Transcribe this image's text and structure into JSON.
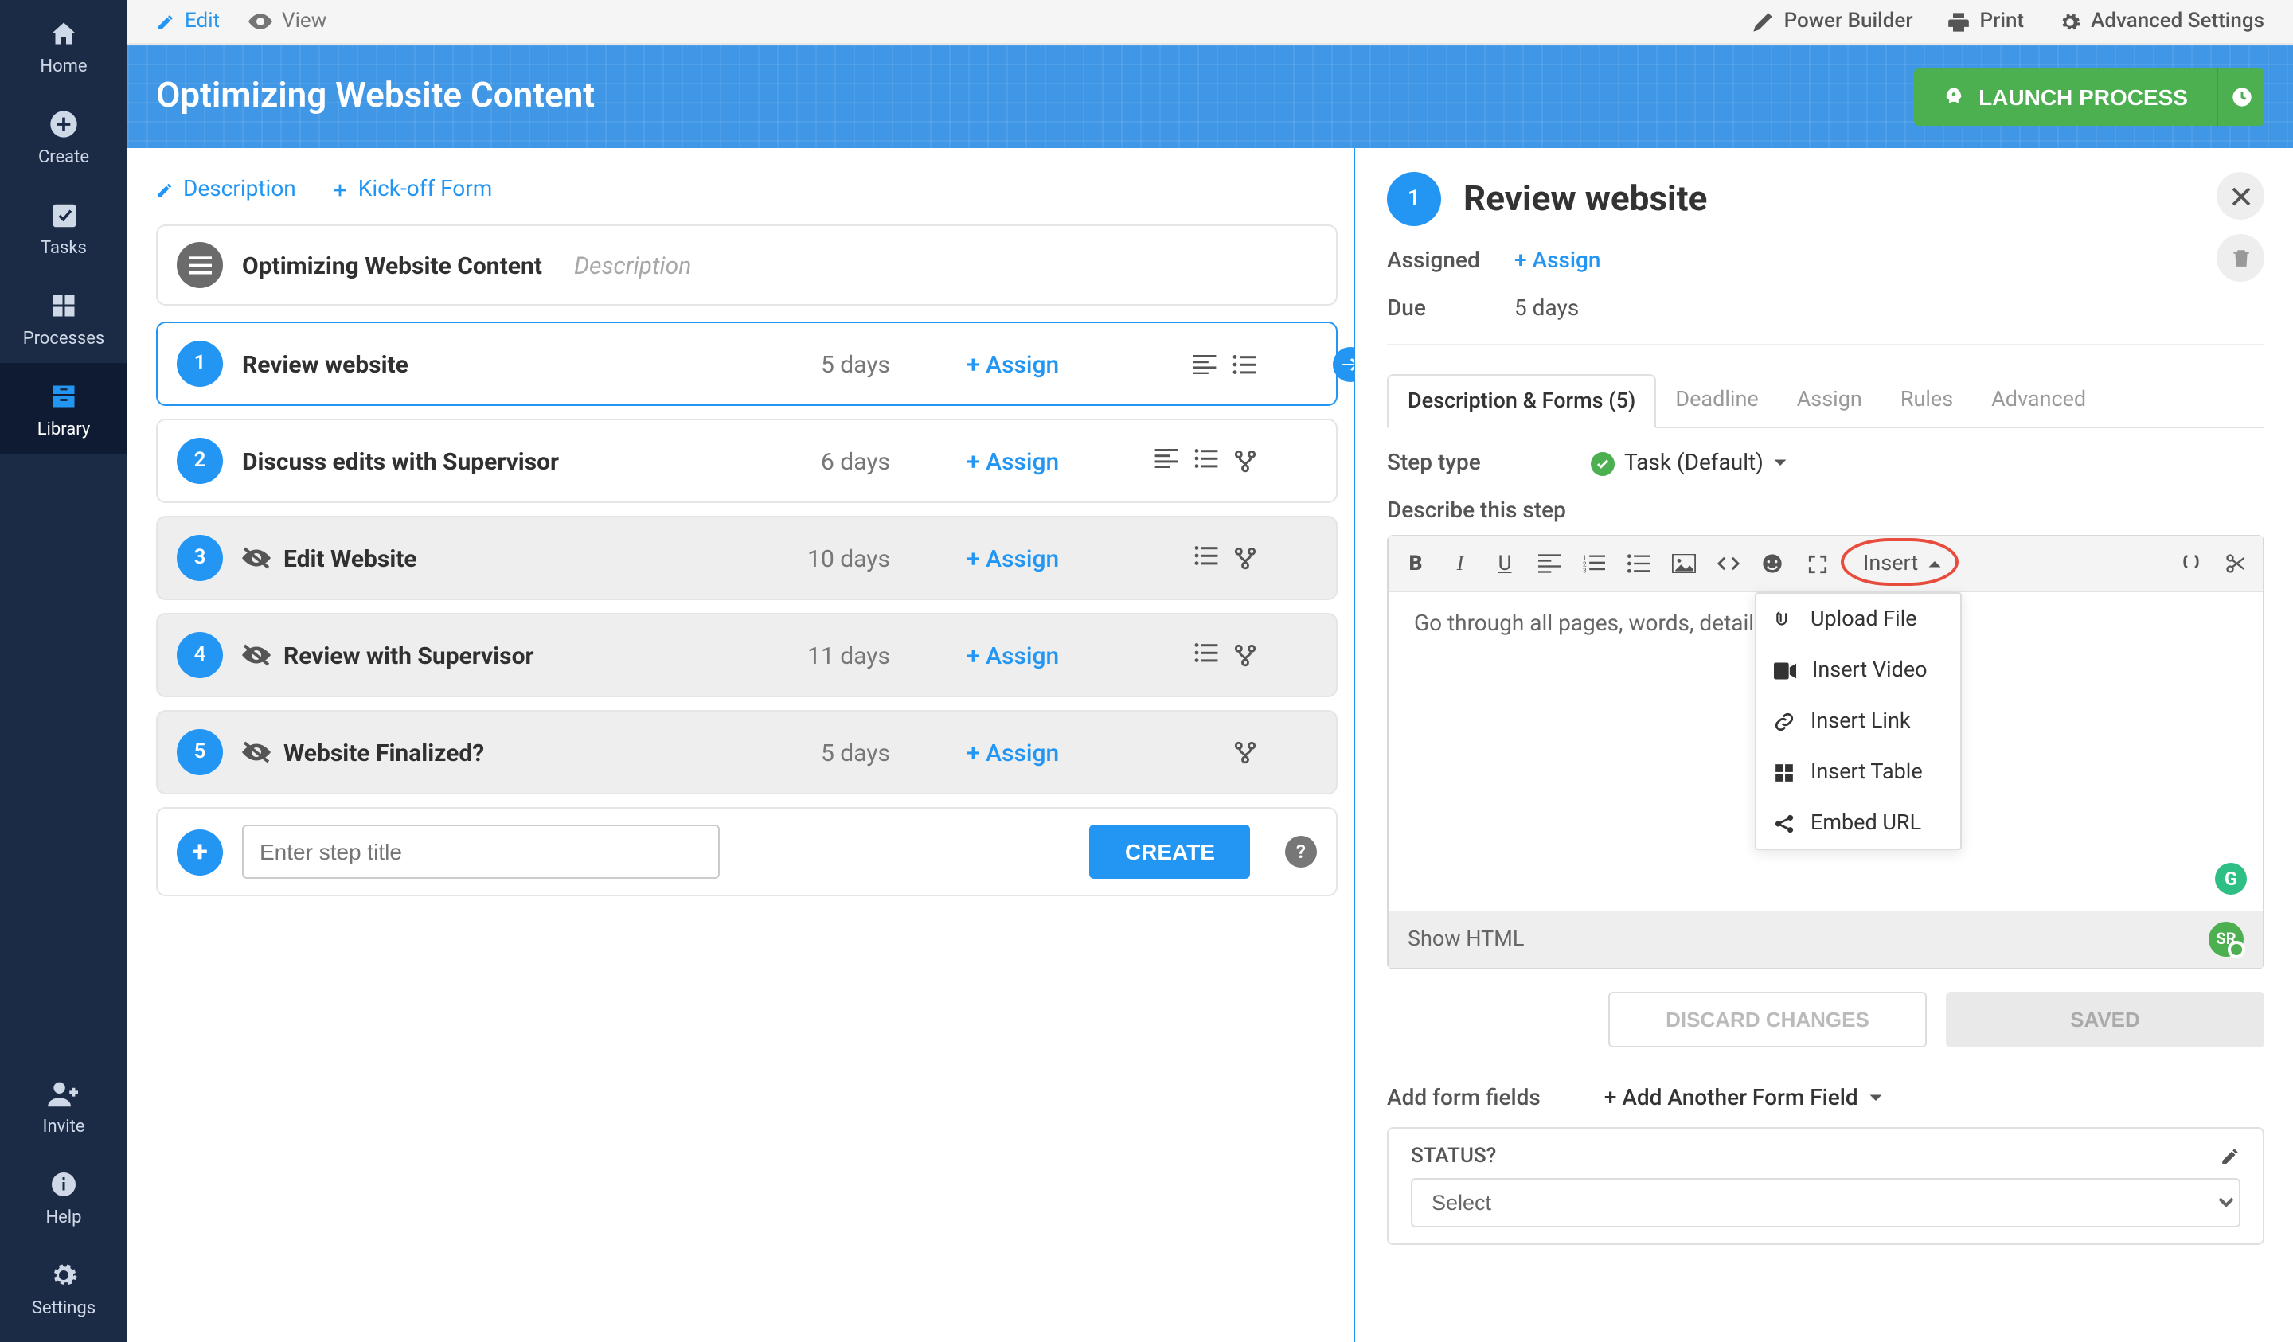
{
  "sidebar": {
    "items": [
      {
        "label": "Home"
      },
      {
        "label": "Create"
      },
      {
        "label": "Tasks"
      },
      {
        "label": "Processes"
      },
      {
        "label": "Library"
      }
    ],
    "bottom": [
      {
        "label": "Invite"
      },
      {
        "label": "Help"
      },
      {
        "label": "Settings"
      }
    ]
  },
  "topbar": {
    "edit": "Edit",
    "view": "View",
    "power": "Power Builder",
    "print": "Print",
    "advanced": "Advanced Settings"
  },
  "hero": {
    "title": "Optimizing Website Content",
    "launch": "LAUNCH PROCESS"
  },
  "subnav": {
    "desc": "Description",
    "kick": "Kick-off Form"
  },
  "headRow": {
    "title": "Optimizing Website Content",
    "desc": "Description"
  },
  "steps": [
    {
      "n": "1",
      "title": "Review website",
      "due": "5 days",
      "assign": "+ Assign",
      "icons": [
        "align",
        "list"
      ],
      "selected": true,
      "shaded": false,
      "hidden": false,
      "arrow": true
    },
    {
      "n": "2",
      "title": "Discuss edits with Supervisor",
      "due": "6 days",
      "assign": "+ Assign",
      "icons": [
        "align",
        "list",
        "branch"
      ],
      "shaded": false,
      "hidden": false
    },
    {
      "n": "3",
      "title": "Edit Website",
      "due": "10 days",
      "assign": "+ Assign",
      "icons": [
        "list",
        "branch"
      ],
      "shaded": true,
      "hidden": true
    },
    {
      "n": "4",
      "title": "Review with Supervisor",
      "due": "11 days",
      "assign": "+ Assign",
      "icons": [
        "list",
        "branch"
      ],
      "shaded": true,
      "hidden": true
    },
    {
      "n": "5",
      "title": "Website Finalized?",
      "due": "5 days",
      "assign": "+ Assign",
      "icons": [
        "branch"
      ],
      "shaded": true,
      "hidden": true
    }
  ],
  "newstep": {
    "placeholder": "Enter step title",
    "create": "CREATE"
  },
  "right": {
    "num": "1",
    "title": "Review website",
    "assignedLabel": "Assigned",
    "assignLink": "+ Assign",
    "dueLabel": "Due",
    "dueValue": "5 days",
    "tabs": [
      "Description & Forms (5)",
      "Deadline",
      "Assign",
      "Rules",
      "Advanced"
    ],
    "stepTypeLabel": "Step type",
    "stepTypeValue": "Task (Default)",
    "describeLabel": "Describe this step",
    "insertBtn": "Insert",
    "insertMenu": [
      "Upload File",
      "Insert Video",
      "Insert Link",
      "Insert Table",
      "Embed URL"
    ],
    "bodyText": "Go through all pages, words, details,",
    "showHtml": "Show HTML",
    "discard": "DISCARD CHANGES",
    "saved": "SAVED",
    "addFieldsLabel": "Add form fields",
    "addAnother": "+ Add Another Form Field",
    "fieldTitle": "STATUS?",
    "fieldPlaceholder": "Select",
    "srBadge": "SR",
    "gBadge": "G"
  }
}
